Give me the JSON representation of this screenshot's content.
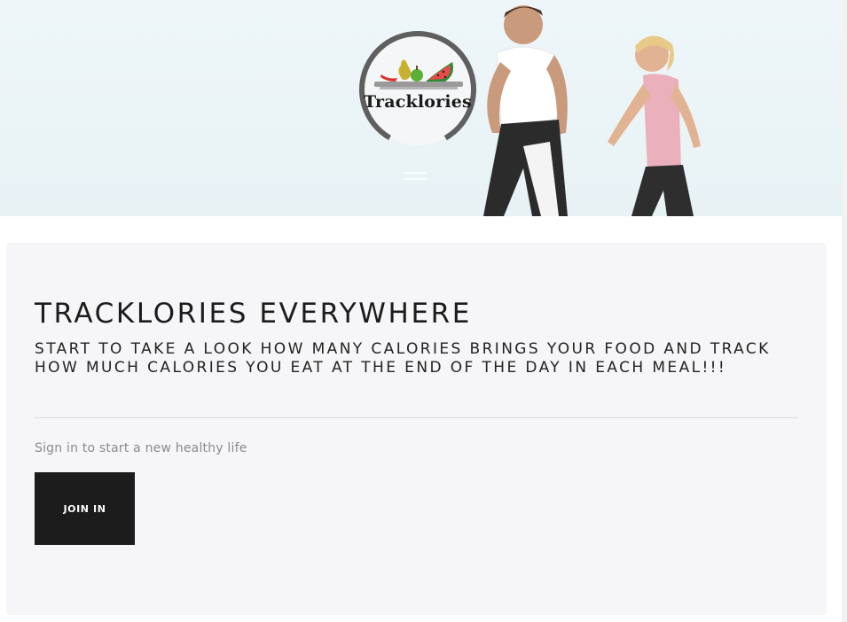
{
  "header": {
    "logo_text": "Tracklories",
    "menu_icon": "hamburger-menu-icon"
  },
  "main": {
    "title": "TRACKLORIES EVERYWHERE",
    "subtitle": "START TO TAKE A LOOK HOW MANY CALORIES BRINGS YOUR FOOD AND TRACK HOW MUCH CALORIES YOU EAT AT THE END OF THE DAY IN EACH MEAL!!!",
    "signin_text": "Sign in to start a new healthy life",
    "join_label": "JOIN IN"
  },
  "colors": {
    "hero_background": "#eef6f9",
    "card_background": "#f6f6f8",
    "button_background": "#1c1c1c",
    "button_text": "#ffffff",
    "logo_ring": "#5f5f5f",
    "watermelon": "#e84a4a"
  }
}
